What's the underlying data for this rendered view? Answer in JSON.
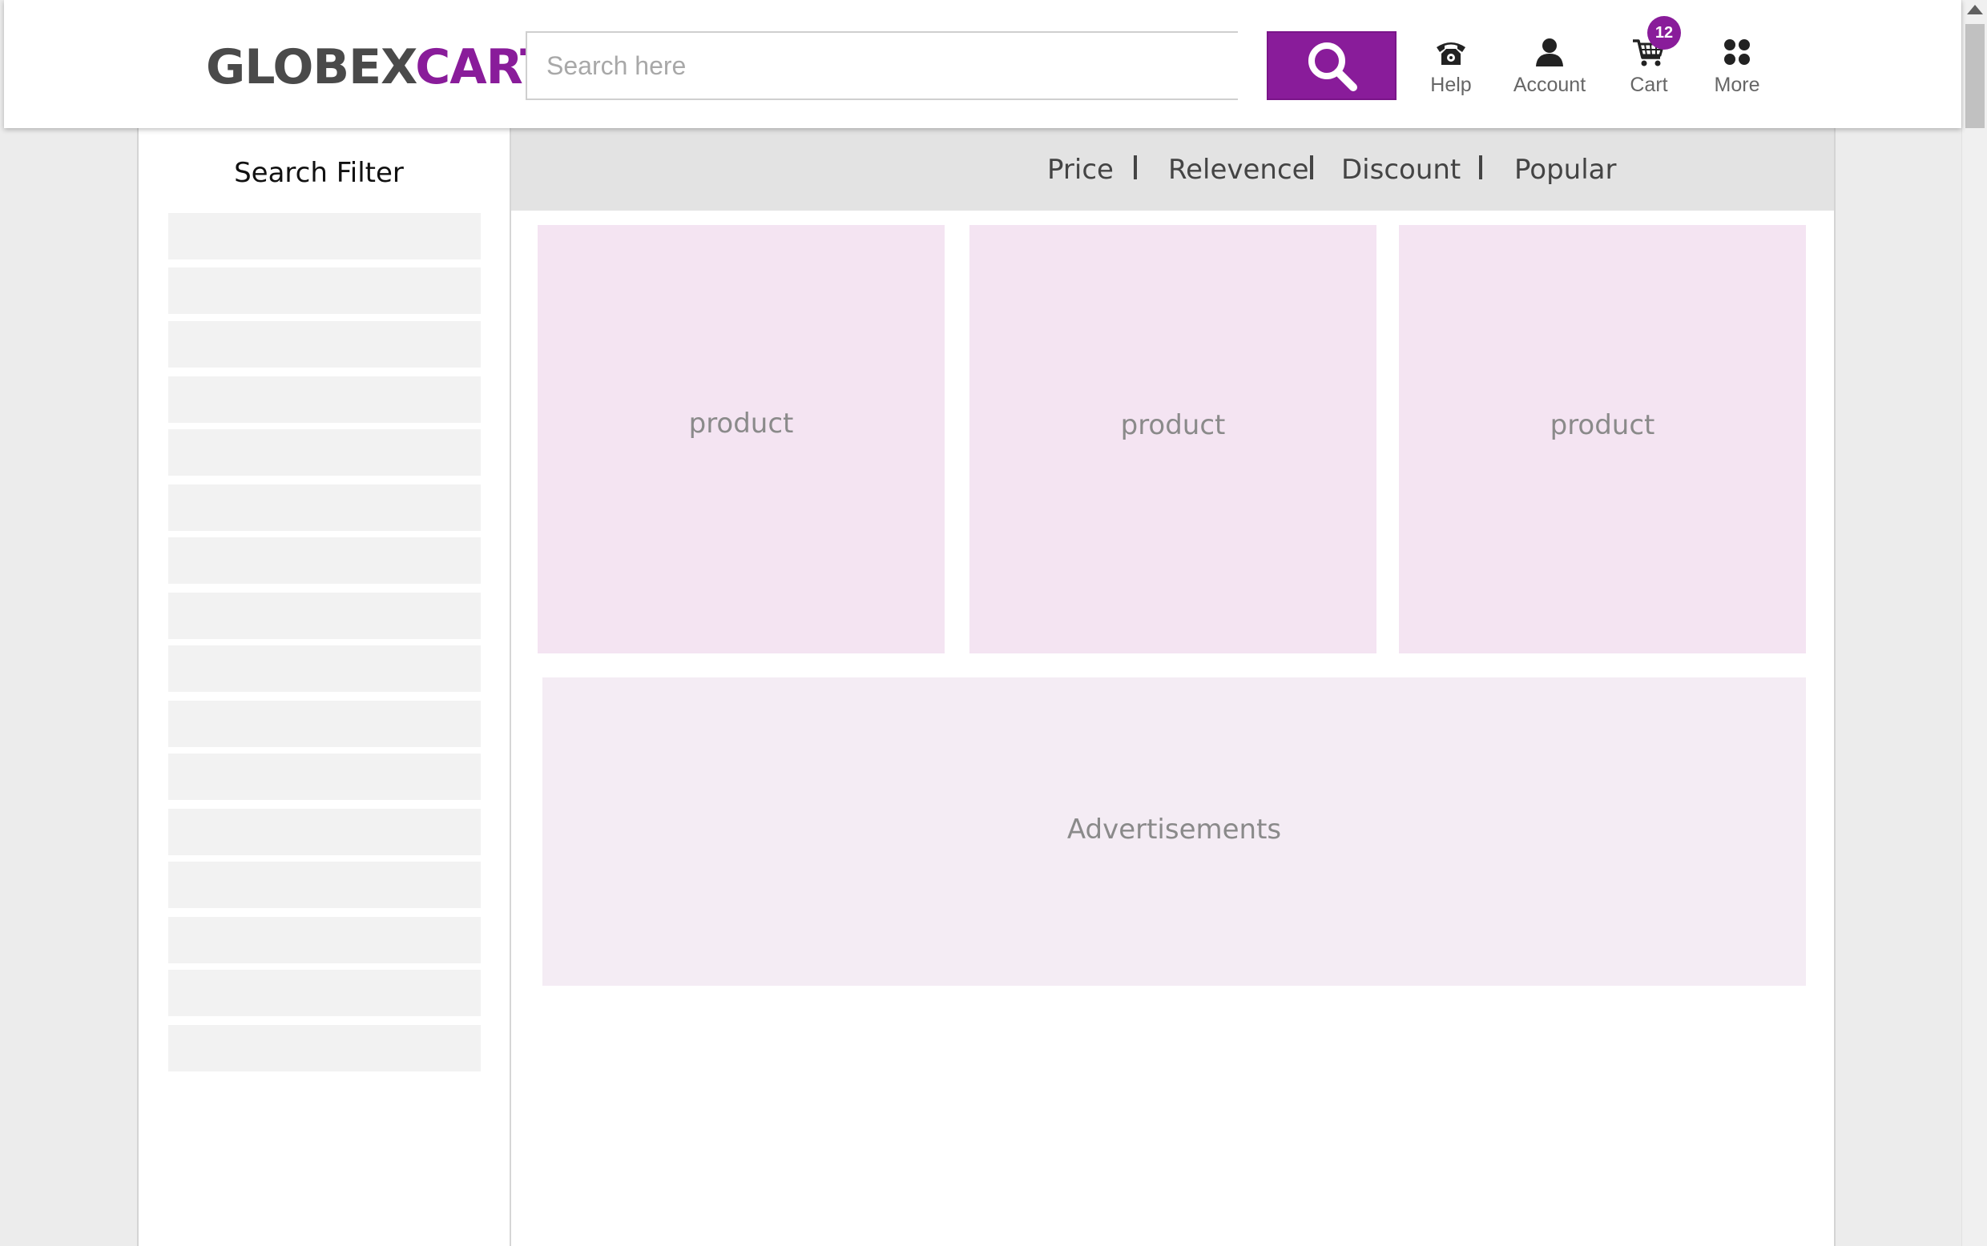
{
  "header": {
    "logo_part1": "GLOBEX",
    "logo_part2": "CART",
    "search_placeholder": "Search here",
    "search_icon": "magnifier-icon",
    "nav": [
      {
        "label": "Help",
        "icon": "telephone-icon"
      },
      {
        "label": "Account",
        "icon": "user-icon"
      },
      {
        "label": "Cart",
        "icon": "shopping-cart-icon",
        "badge": "12"
      },
      {
        "label": "More",
        "icon": "grid-dots-icon"
      }
    ]
  },
  "sidebar": {
    "title": "Search Filter",
    "filter_count": 16
  },
  "sortbar": {
    "options": [
      "Price",
      "Relevence",
      "Discount",
      "Popular"
    ],
    "separator": "|"
  },
  "products": [
    {
      "label": "product"
    },
    {
      "label": "product"
    },
    {
      "label": "product"
    }
  ],
  "ads": {
    "label": "Advertisements"
  },
  "colors": {
    "brand": "#891c9a",
    "logo_dark": "#4a4a4a",
    "product_bg": "#f4e4f2",
    "ads_bg": "#f4ecf4",
    "sortbar_bg": "#e3e3e3",
    "filter_bg": "#f2f2f2",
    "page_bg": "#ececec"
  }
}
